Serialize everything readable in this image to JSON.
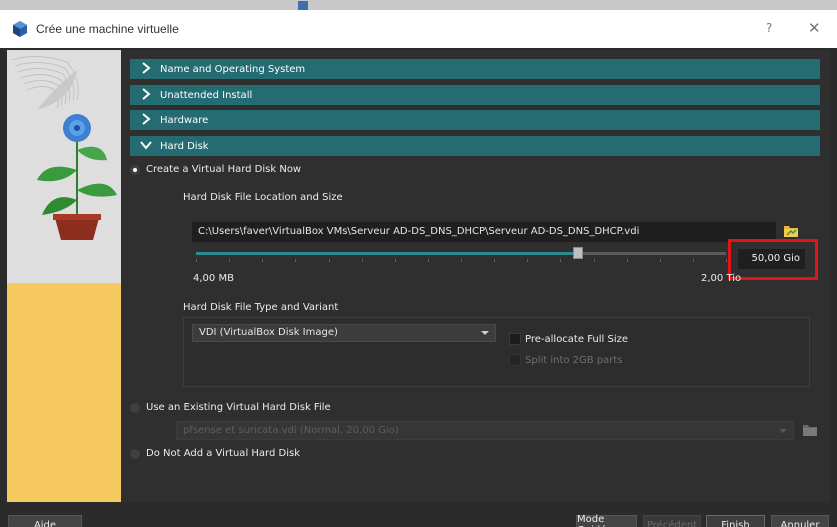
{
  "window": {
    "title": "Crée une machine virtuelle",
    "help_label": "?",
    "close_label": "✕"
  },
  "sections": {
    "name_os": "Name and Operating System",
    "unattended": "Unattended Install",
    "hardware": "Hardware",
    "hard_disk": "Hard Disk"
  },
  "hard_disk": {
    "option_create": "Create a Virtual Hard Disk Now",
    "location_heading": "Hard Disk File Location and Size",
    "file_path": "C:\\Users\\faver\\VirtualBox VMs\\Serveur AD-DS_DNS_DHCP\\Serveur AD-DS_DNS_DHCP.vdi",
    "size_value": "50,00 Gio",
    "size_fraction": 0.72,
    "min_label": "4,00 MB",
    "max_label": "2,00 Tio",
    "type_heading": "Hard Disk File Type and Variant",
    "type_selected": "VDI (VirtualBox Disk Image)",
    "preallocate_label": "Pre-allocate Full Size",
    "split_label": "Split into 2GB parts",
    "option_existing": "Use an Existing Virtual Hard Disk File",
    "existing_selected": "pfsense et suricata.vdi (Normal, 20,00 Gio)",
    "option_none": "Do Not Add a Virtual Hard Disk"
  },
  "footer": {
    "help": "Aide",
    "guided": "Mode Guidé",
    "previous": "Précédent",
    "finish": "Finish",
    "cancel": "Annuler"
  },
  "colors": {
    "section_bar": "#246b72",
    "slider_fill": "#2d8a93",
    "highlight": "#e0141a"
  }
}
